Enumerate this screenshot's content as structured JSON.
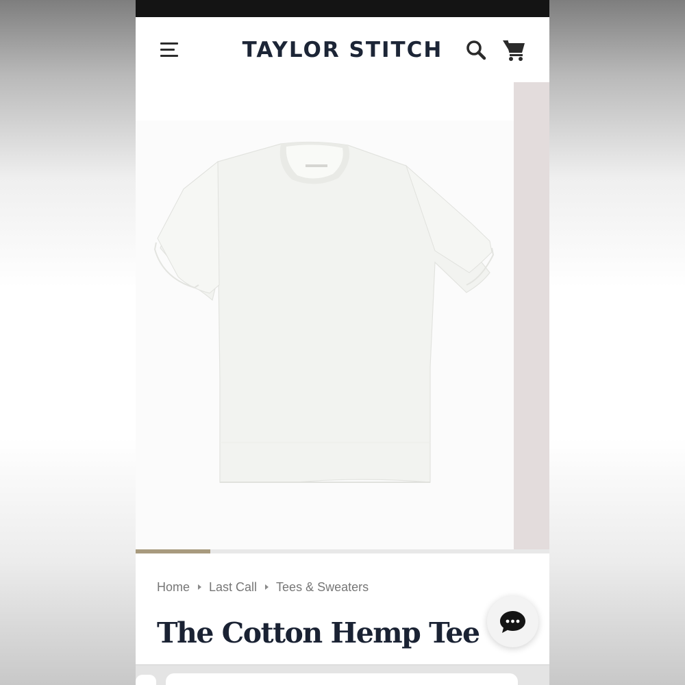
{
  "header": {
    "brand": "TAYLOR STITCH",
    "menu_icon": "hamburger-menu-icon",
    "search_icon": "search-icon",
    "cart_icon": "shopping-cart-icon",
    "brand_color": "#1c2536"
  },
  "gallery": {
    "product_image": "white-tshirt-image",
    "slide_progress": 0.18,
    "progress_color": "#a89a7e",
    "next_slide_color": "#e3dcdc"
  },
  "breadcrumb": {
    "items": [
      "Home",
      "Last Call",
      "Tees & Sweaters"
    ]
  },
  "product": {
    "title": "The Cotton Hemp Tee"
  },
  "chat": {
    "icon": "chat-bubble-icon"
  }
}
